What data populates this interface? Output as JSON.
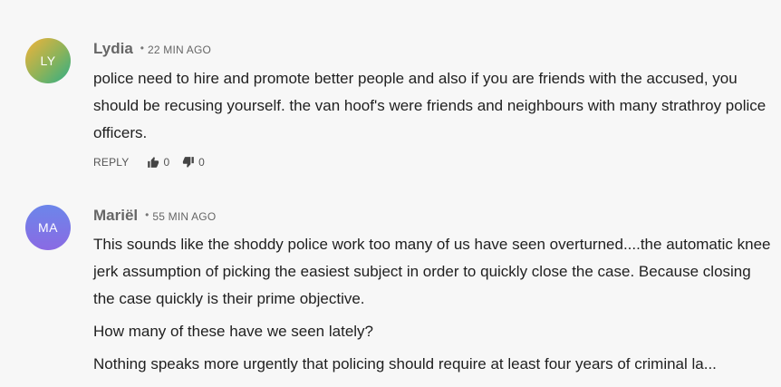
{
  "comments": [
    {
      "initials": "LY",
      "author": "Lydia",
      "time": "22 MIN AGO",
      "paragraphs": [
        "police need to hire and promote better people and also if you are friends with the accused, you should be recusing yourself. the van hoof's were friends and neighbours with many strathroy police officers."
      ],
      "reply_label": "REPLY",
      "likes": "0",
      "dislikes": "0",
      "avatar_colors": [
        "#f2b33a",
        "#2fae86"
      ]
    },
    {
      "initials": "MA",
      "author": "Mariël",
      "time": "55 MIN AGO",
      "paragraphs": [
        "This sounds like the shoddy police work too many of us have seen overturned....the automatic knee jerk assumption of picking the easiest subject in order to quickly close the case. Because closing the case quickly is their prime objective.",
        "How many of these have we seen lately?",
        "Nothing speaks more urgently that policing should require at least four years of criminal la..."
      ],
      "avatar_colors": [
        "#6c86ea",
        "#8a6ae3"
      ]
    }
  ]
}
